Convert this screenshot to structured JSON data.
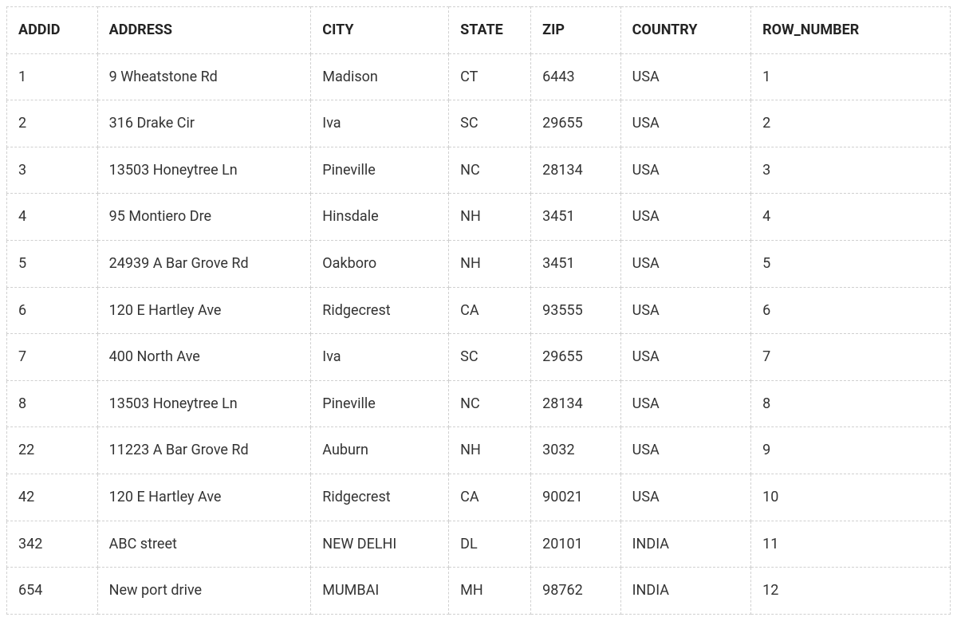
{
  "table": {
    "headers": [
      "ADDID",
      "ADDRESS",
      "CITY",
      "STATE",
      "ZIP",
      "COUNTRY",
      "ROW_NUMBER"
    ],
    "rows": [
      {
        "addid": "1",
        "address": "9 Wheatstone Rd",
        "city": "Madison",
        "state": "CT",
        "zip": "6443",
        "country": "USA",
        "row_number": "1"
      },
      {
        "addid": "2",
        "address": "316 Drake Cir",
        "city": "Iva",
        "state": "SC",
        "zip": "29655",
        "country": "USA",
        "row_number": "2"
      },
      {
        "addid": "3",
        "address": "13503 Honeytree Ln",
        "city": "Pineville",
        "state": "NC",
        "zip": "28134",
        "country": "USA",
        "row_number": "3"
      },
      {
        "addid": "4",
        "address": "95 Montiero Dre",
        "city": "Hinsdale",
        "state": "NH",
        "zip": "3451",
        "country": "USA",
        "row_number": "4"
      },
      {
        "addid": "5",
        "address": "24939 A Bar Grove Rd",
        "city": "Oakboro",
        "state": "NH",
        "zip": "3451",
        "country": "USA",
        "row_number": "5"
      },
      {
        "addid": "6",
        "address": "120 E Hartley Ave",
        "city": "Ridgecrest",
        "state": "CA",
        "zip": "93555",
        "country": "USA",
        "row_number": "6"
      },
      {
        "addid": "7",
        "address": "400 North Ave",
        "city": "Iva",
        "state": "SC",
        "zip": "29655",
        "country": "USA",
        "row_number": "7"
      },
      {
        "addid": "8",
        "address": "13503 Honeytree Ln",
        "city": "Pineville",
        "state": "NC",
        "zip": "28134",
        "country": "USA",
        "row_number": "8"
      },
      {
        "addid": "22",
        "address": "11223 A Bar Grove Rd",
        "city": "Auburn",
        "state": "NH",
        "zip": "3032",
        "country": "USA",
        "row_number": "9"
      },
      {
        "addid": "42",
        "address": "120 E Hartley Ave",
        "city": "Ridgecrest",
        "state": "CA",
        "zip": "90021",
        "country": "USA",
        "row_number": "10"
      },
      {
        "addid": "342",
        "address": "ABC street",
        "city": "NEW DELHI",
        "state": "DL",
        "zip": "20101",
        "country": "INDIA",
        "row_number": "11"
      },
      {
        "addid": "654",
        "address": "New port drive",
        "city": "MUMBAI",
        "state": "MH",
        "zip": "98762",
        "country": "INDIA",
        "row_number": "12"
      }
    ]
  }
}
